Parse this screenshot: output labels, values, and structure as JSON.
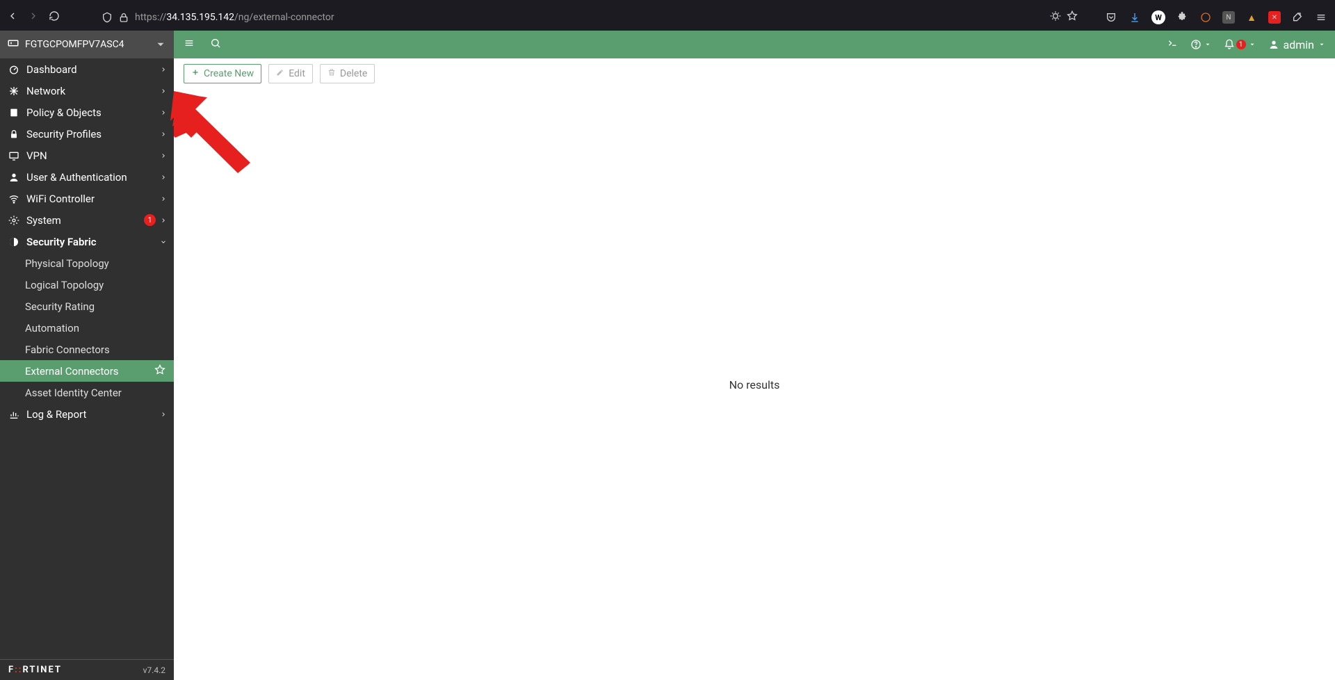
{
  "browser": {
    "url_prefix": "https://",
    "url_host": "34.135.195.142",
    "url_path": "/ng/external-connector"
  },
  "device_name": "FGTGCPOMFPV7ASC4",
  "sidebar": {
    "items": [
      {
        "label": "Dashboard"
      },
      {
        "label": "Network"
      },
      {
        "label": "Policy & Objects"
      },
      {
        "label": "Security Profiles"
      },
      {
        "label": "VPN"
      },
      {
        "label": "User & Authentication"
      },
      {
        "label": "WiFi Controller"
      },
      {
        "label": "System",
        "badge": "1"
      },
      {
        "label": "Security Fabric"
      },
      {
        "label": "Log & Report"
      }
    ],
    "fabric_subs": [
      {
        "label": "Physical Topology"
      },
      {
        "label": "Logical Topology"
      },
      {
        "label": "Security Rating"
      },
      {
        "label": "Automation"
      },
      {
        "label": "Fabric Connectors"
      },
      {
        "label": "External Connectors"
      },
      {
        "label": "Asset Identity Center"
      }
    ]
  },
  "footer": {
    "version": "v7.4.2"
  },
  "topbar": {
    "notif_count": "1",
    "username": "admin"
  },
  "toolbar": {
    "create": "Create New",
    "edit": "Edit",
    "del": "Delete"
  },
  "content": {
    "no_results": "No results"
  }
}
